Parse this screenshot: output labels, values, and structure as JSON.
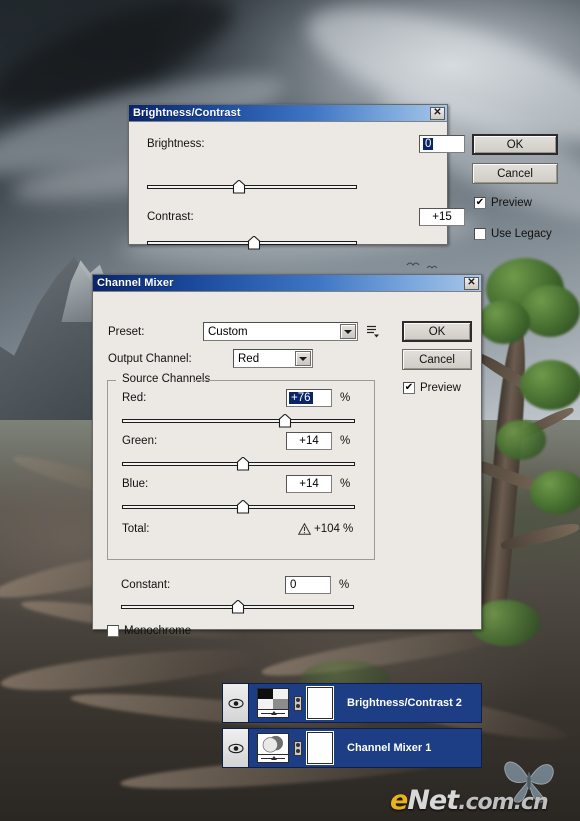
{
  "watermark": {
    "prefix": "e",
    "mid": "Net",
    "suffix": ".com.cn"
  },
  "brightness_contrast_dialog": {
    "title": "Brightness/Contrast",
    "close_label": "✕",
    "brightness_label": "Brightness:",
    "brightness_value": "0",
    "brightness_slider_percent": 44,
    "contrast_label": "Contrast:",
    "contrast_value": "+15",
    "contrast_slider_percent": 51,
    "ok_label": "OK",
    "cancel_label": "Cancel",
    "preview_label": "Preview",
    "preview_checked": "✔",
    "use_legacy_label": "Use Legacy",
    "use_legacy_checked": ""
  },
  "channel_mixer_dialog": {
    "title": "Channel Mixer",
    "close_label": "✕",
    "preset_label": "Preset:",
    "preset_value": "Custom",
    "preset_options_icon": "preset-options-icon",
    "output_channel_label": "Output Channel:",
    "output_channel_value": "Red",
    "source_channels_label": "Source Channels",
    "channels": [
      {
        "label": "Red:",
        "value": "+76",
        "unit": "%",
        "slider_percent": 70,
        "selected": true
      },
      {
        "label": "Green:",
        "value": "+14",
        "unit": "%",
        "slider_percent": 52,
        "selected": false
      },
      {
        "label": "Blue:",
        "value": "+14",
        "unit": "%",
        "slider_percent": 52,
        "selected": false
      }
    ],
    "total_label": "Total:",
    "total_value": "+104",
    "total_unit": "%",
    "total_warning_icon": "warning-triangle-icon",
    "constant_label": "Constant:",
    "constant_value": "0",
    "constant_unit": "%",
    "constant_slider_percent": 50,
    "monochrome_label": "Monochrome",
    "monochrome_checked": "",
    "ok_label": "OK",
    "cancel_label": "Cancel",
    "preview_label": "Preview",
    "preview_checked": "✔"
  },
  "layers_panel": {
    "rows": [
      {
        "name": "Brightness/Contrast 2",
        "visible_icon": "eye-icon",
        "thumb": "brightness-contrast-thumb",
        "link_icon": "link-icon",
        "mask": "layer-mask-thumb"
      },
      {
        "name": "Channel Mixer 1",
        "visible_icon": "eye-icon",
        "thumb": "channel-mixer-thumb",
        "link_icon": "link-icon",
        "mask": "layer-mask-thumb"
      }
    ]
  },
  "colors": {
    "titlebar_start": "#0a246a",
    "titlebar_end": "#a8c6e8",
    "dialog_face": "#ece9e4",
    "selection_blue": "#0a246a",
    "layer_row_blue": "#1d3d84",
    "watermark_yellow": "#e8b21f"
  }
}
